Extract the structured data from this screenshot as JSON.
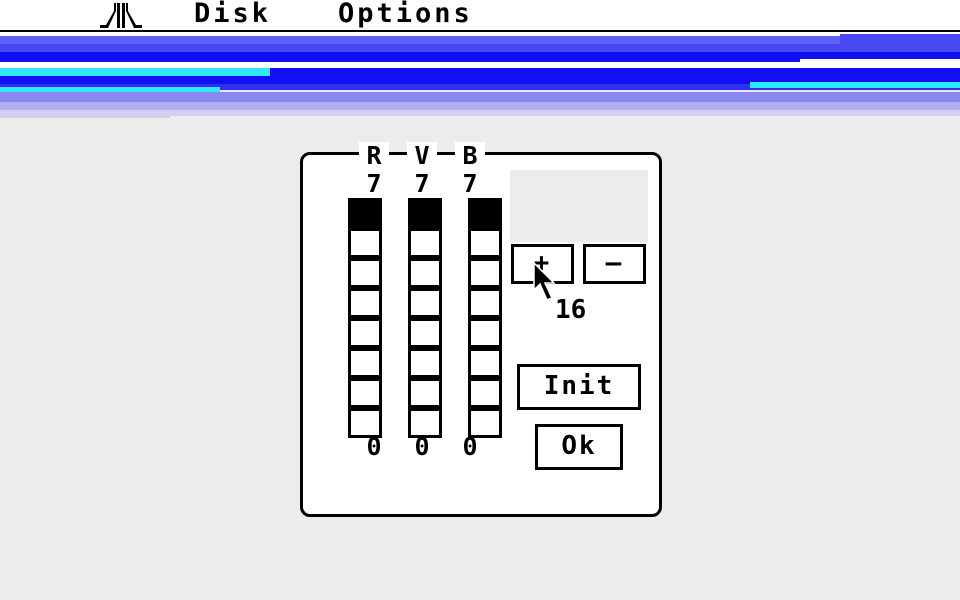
{
  "menubar": {
    "logo_icon": "atari-fuji-logo-icon",
    "items": [
      "Disk",
      "Options"
    ]
  },
  "desktop": {
    "stripe_colors": [
      "#1010f0",
      "#5858f8",
      "#30e8f8",
      "#b0b0f0"
    ]
  },
  "palette_dialog": {
    "channels": [
      {
        "label": "R",
        "value": "7",
        "min": "0",
        "level": 1
      },
      {
        "label": "V",
        "value": "7",
        "min": "0",
        "level": 1
      },
      {
        "label": "B",
        "value": "7",
        "min": "0",
        "level": 1
      }
    ],
    "plus_label": "+",
    "minus_label": "–",
    "color_count": "16",
    "init_label": "Init",
    "ok_label": "Ok"
  }
}
